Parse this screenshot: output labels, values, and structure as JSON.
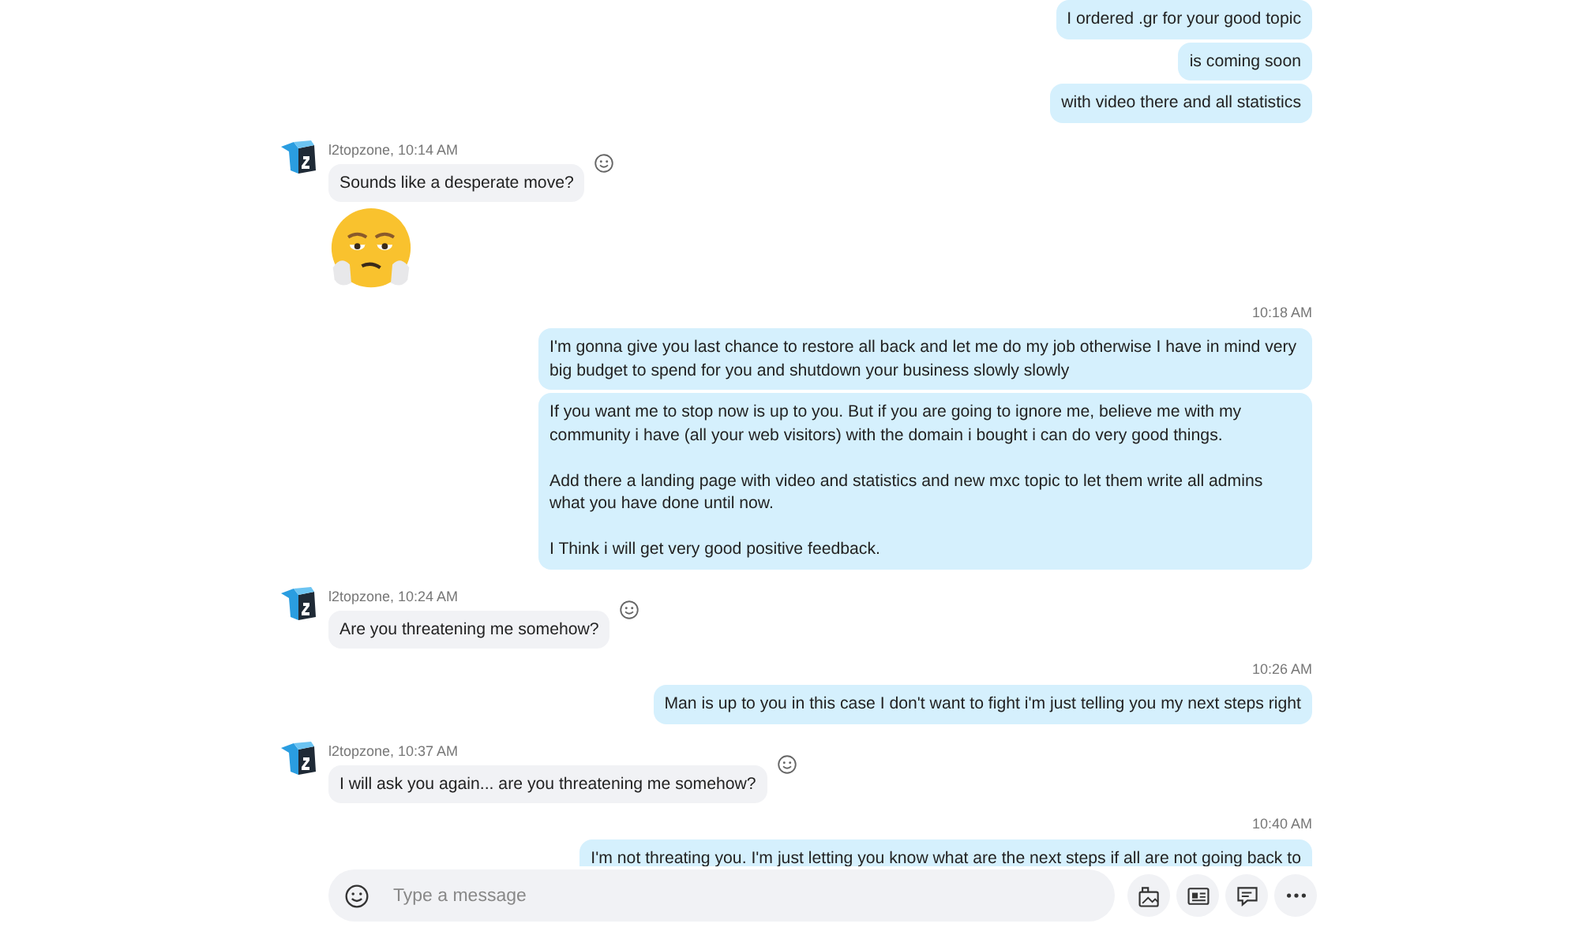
{
  "messages": [
    {
      "kind": "outgoing",
      "bubbles": [
        {
          "text": [
            "I ordered .gr for your good topic"
          ]
        },
        {
          "text": [
            "is coming soon"
          ]
        },
        {
          "text": [
            "with video there and all statistics"
          ]
        }
      ]
    },
    {
      "kind": "incoming",
      "header": "l2topzone, 10:14 AM",
      "bubbles": [
        {
          "kind": "text",
          "text": [
            "Sounds like a desperate move?"
          ]
        },
        {
          "kind": "sticker"
        }
      ]
    },
    {
      "kind": "outgoing",
      "time": "10:18 AM",
      "bubbles": [
        {
          "text": [
            "I'm gonna give you last chance to restore all back and let me do my job otherwise I have in mind very big budget to spend for you and shutdown your business slowly slowly"
          ]
        },
        {
          "text": [
            "If you want me to stop now is up to you. But if you are going to ignore me, believe me with my community i have (all your web visitors) with the domain i bought i can do very good things.",
            "Add there a landing page with video and statistics and new mxc topic to let them write all admins what you have done until now.",
            "I Think i will get very good positive feedback."
          ]
        }
      ]
    },
    {
      "kind": "incoming",
      "header": "l2topzone, 10:24 AM",
      "bubbles": [
        {
          "kind": "text",
          "text": [
            "Are you threatening me somehow?"
          ]
        }
      ]
    },
    {
      "kind": "outgoing",
      "time": "10:26 AM",
      "bubbles": [
        {
          "text": [
            "Man is up to you in this case I don't want to fight i'm just telling you my next steps right"
          ]
        }
      ]
    },
    {
      "kind": "incoming",
      "header": "l2topzone, 10:37 AM",
      "bubbles": [
        {
          "kind": "text",
          "text": [
            "I will ask you again... are you threatening me somehow?"
          ]
        }
      ]
    },
    {
      "kind": "outgoing",
      "time": "10:40 AM",
      "bubbles": [
        {
          "text": [
            "I'm not threating you. I'm just letting you know what are the next steps if all are not going back to"
          ]
        }
      ]
    }
  ],
  "composer": {
    "placeholder": "Type a message"
  }
}
